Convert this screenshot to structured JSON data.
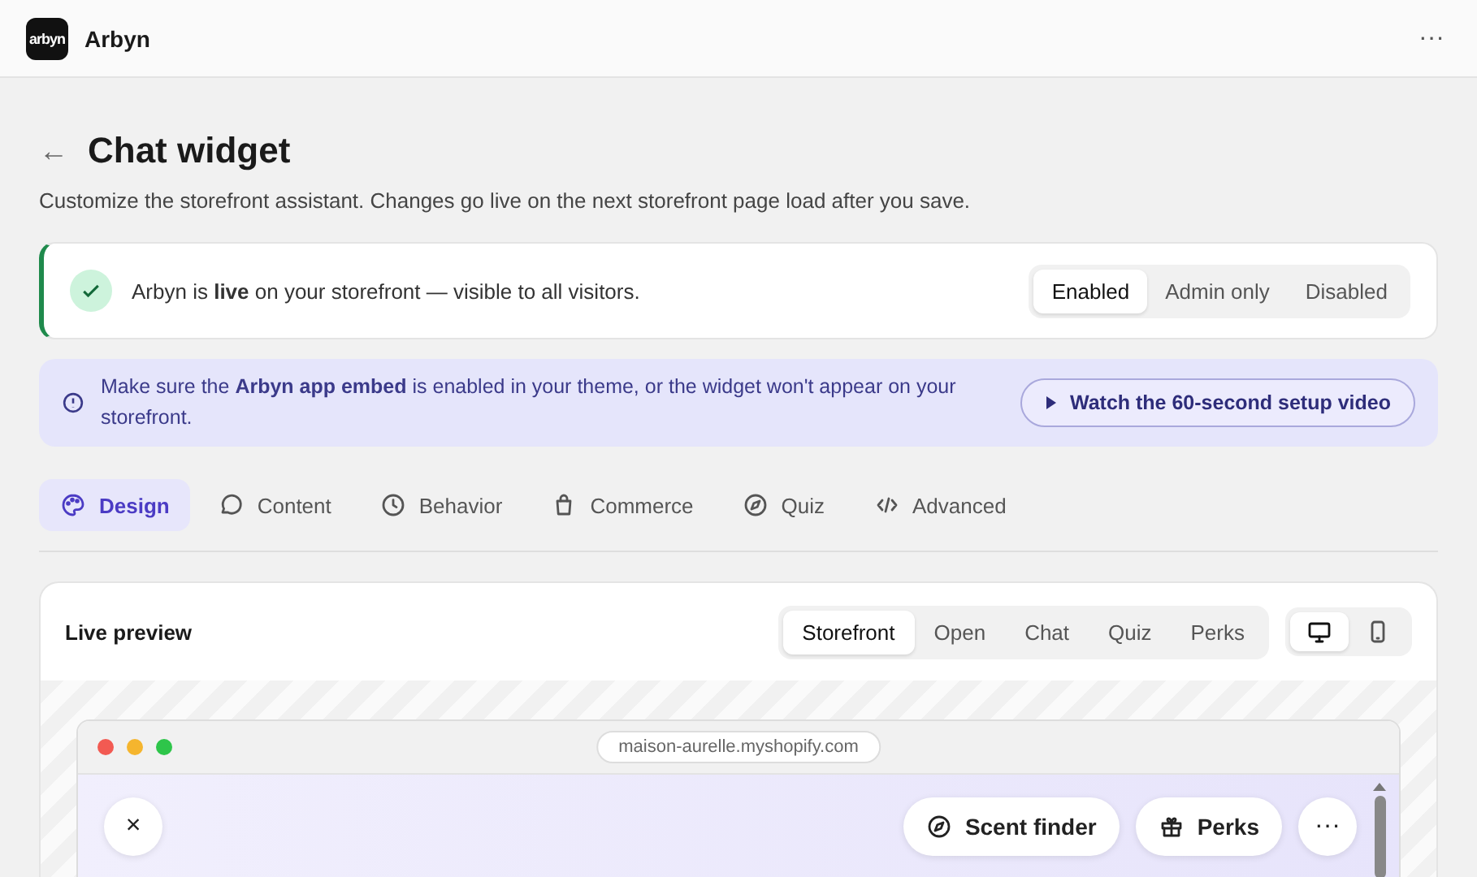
{
  "app_bar": {
    "logo_text": "arbyn",
    "app_name": "Arbyn",
    "menu": "···"
  },
  "header": {
    "back": "←",
    "title": "Chat widget",
    "description": "Customize the storefront assistant. Changes go live on the next storefront page load after you save."
  },
  "status": {
    "message": "Arbyn is **live** on your storefront — visible to all visitors.",
    "modes": [
      {
        "label": "Enabled",
        "selected": true
      },
      {
        "label": "Admin only",
        "selected": false
      },
      {
        "label": "Disabled",
        "selected": false
      }
    ]
  },
  "notice": {
    "message": "Make sure the **Arbyn app embed** is enabled in your theme, or the widget won't appear on your storefront.",
    "button": "Watch the 60-second setup video"
  },
  "tabs": [
    {
      "label": "Design",
      "kind": "palette",
      "selected": true
    },
    {
      "label": "Content",
      "kind": "bubble",
      "selected": false
    },
    {
      "label": "Behavior",
      "kind": "clock",
      "selected": false
    },
    {
      "label": "Commerce",
      "kind": "bag",
      "selected": false
    },
    {
      "label": "Quiz",
      "kind": "compass",
      "selected": false
    },
    {
      "label": "Advanced",
      "kind": "code",
      "selected": false
    }
  ],
  "preview": {
    "title": "Live preview",
    "views": [
      {
        "label": "Storefront",
        "selected": true
      },
      {
        "label": "Open",
        "selected": false
      },
      {
        "label": "Chat",
        "selected": false
      },
      {
        "label": "Quiz",
        "selected": false
      },
      {
        "label": "Perks",
        "selected": false
      }
    ],
    "devices": [
      {
        "kind": "desktop",
        "selected": true
      },
      {
        "kind": "mobile",
        "selected": false
      }
    ],
    "browser": {
      "url": "maison-aurelle.myshopify.com",
      "close": "×",
      "buttons": [
        {
          "label": "Scent finder",
          "kind": "compass"
        },
        {
          "label": "Perks",
          "kind": "gift"
        }
      ],
      "more": "···"
    }
  }
}
